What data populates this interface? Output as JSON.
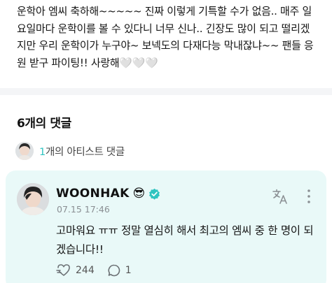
{
  "post": {
    "text": "운학아 엠씨 축하해~~~~~ 진짜 이렇게 기특할 수가 없음.. 매주 일\n요일마다 운학이를 볼 수 있다니 너무 신나.. 긴장도 많이 되고 떨리겠\n지만 우리 운학이가 누구야~ 보넥도의 다재다능 막내잖냐~~ 팬들 응\n원 받구 파이팅!! 사랑해🤍🤍🤍"
  },
  "comments": {
    "count_label": "6개의 댓글",
    "artist_count": "1",
    "artist_label": "개의 아티스트 댓글"
  },
  "comment": {
    "author": "WOONHAK",
    "author_emoji": "😎",
    "timestamp": "07.15 17:46",
    "text": "고마워요 ㅠㅠ 정말 열심히 해서 최고의 엠씨 중 한 명이 되겠습니다!!",
    "likes": "244",
    "replies": "1",
    "verified_color": "#2fc4c0",
    "icons": [
      "verified-icon",
      "translate-icon",
      "more-icon",
      "like-icon",
      "reply-icon"
    ]
  },
  "colors": {
    "accent": "#2fc4c0",
    "card_bg": "#e9f9f8",
    "divider": "#f4f5f7"
  }
}
